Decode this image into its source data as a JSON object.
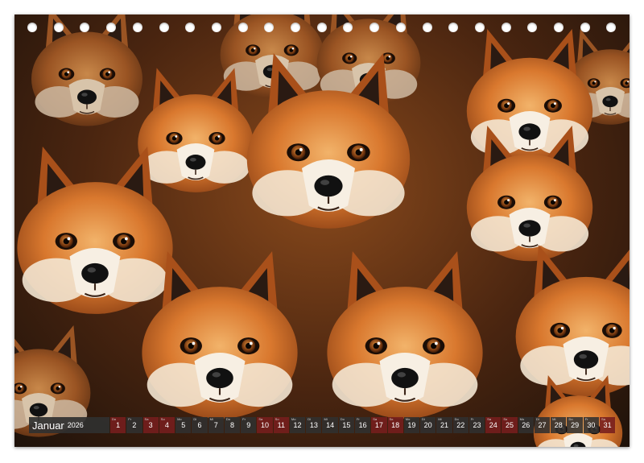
{
  "calendar": {
    "month": "Januar",
    "year": "2026",
    "days": [
      {
        "n": "1",
        "dow": "Do",
        "weekend": true
      },
      {
        "n": "2",
        "dow": "Fr",
        "weekend": false
      },
      {
        "n": "3",
        "dow": "Sa",
        "weekend": true
      },
      {
        "n": "4",
        "dow": "So",
        "weekend": true
      },
      {
        "n": "5",
        "dow": "Mo",
        "weekend": false
      },
      {
        "n": "6",
        "dow": "Di",
        "weekend": false
      },
      {
        "n": "7",
        "dow": "Mi",
        "weekend": false
      },
      {
        "n": "8",
        "dow": "Do",
        "weekend": false
      },
      {
        "n": "9",
        "dow": "Fr",
        "weekend": false
      },
      {
        "n": "10",
        "dow": "Sa",
        "weekend": true
      },
      {
        "n": "11",
        "dow": "So",
        "weekend": true
      },
      {
        "n": "12",
        "dow": "Mo",
        "weekend": false
      },
      {
        "n": "13",
        "dow": "Di",
        "weekend": false
      },
      {
        "n": "14",
        "dow": "Mi",
        "weekend": false
      },
      {
        "n": "15",
        "dow": "Do",
        "weekend": false
      },
      {
        "n": "16",
        "dow": "Fr",
        "weekend": false
      },
      {
        "n": "17",
        "dow": "Sa",
        "weekend": true
      },
      {
        "n": "18",
        "dow": "So",
        "weekend": true
      },
      {
        "n": "19",
        "dow": "Mo",
        "weekend": false
      },
      {
        "n": "20",
        "dow": "Di",
        "weekend": false
      },
      {
        "n": "21",
        "dow": "Mi",
        "weekend": false
      },
      {
        "n": "22",
        "dow": "Do",
        "weekend": false
      },
      {
        "n": "23",
        "dow": "Fr",
        "weekend": false
      },
      {
        "n": "24",
        "dow": "Sa",
        "weekend": true
      },
      {
        "n": "25",
        "dow": "So",
        "weekend": true
      },
      {
        "n": "26",
        "dow": "Mo",
        "weekend": false
      },
      {
        "n": "27",
        "dow": "Di",
        "weekend": false
      },
      {
        "n": "28",
        "dow": "Mi",
        "weekend": false
      },
      {
        "n": "29",
        "dow": "Do",
        "weekend": false
      },
      {
        "n": "30",
        "dow": "Fr",
        "weekend": false
      },
      {
        "n": "31",
        "dow": "Sa",
        "weekend": true
      }
    ]
  },
  "colors": {
    "fur": "#d9782e",
    "fur_dark": "#a9501a",
    "fur_light": "#f2b36a",
    "cream": "#f3e6d2",
    "ear_inner": "#2a1a12",
    "eye": "#8a4410",
    "nose": "#111111"
  }
}
